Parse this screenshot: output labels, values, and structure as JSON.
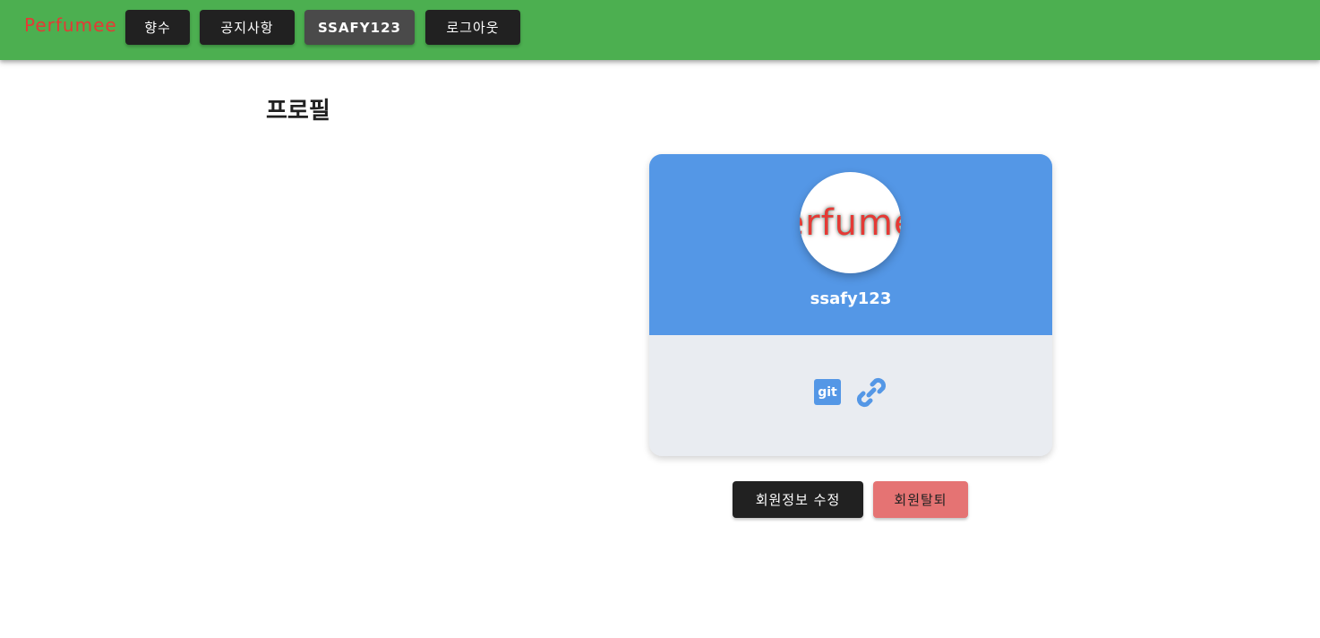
{
  "app": {
    "logo_text": "Perfumee"
  },
  "nav": {
    "items": [
      {
        "label": "향수"
      },
      {
        "label": "공지사항"
      },
      {
        "label": "SSAFY123"
      },
      {
        "label": "로그아웃"
      }
    ]
  },
  "page": {
    "title": "프로필"
  },
  "profile": {
    "avatar_text": "Perfumee",
    "username": "ssafy123",
    "links": {
      "git_label": "git"
    }
  },
  "actions": {
    "edit_label": "회원정보 수정",
    "delete_label": "회원탈퇴"
  },
  "colors": {
    "header": "#4caf50",
    "logo": "#e53935",
    "card_top": "#5497e6",
    "card_bottom": "#e9ecf1",
    "dark_button": "#212121",
    "active_button": "#4a4a4a",
    "danger_button": "#e57373"
  },
  "icons": {
    "git": "git-icon",
    "link": "link-icon"
  }
}
